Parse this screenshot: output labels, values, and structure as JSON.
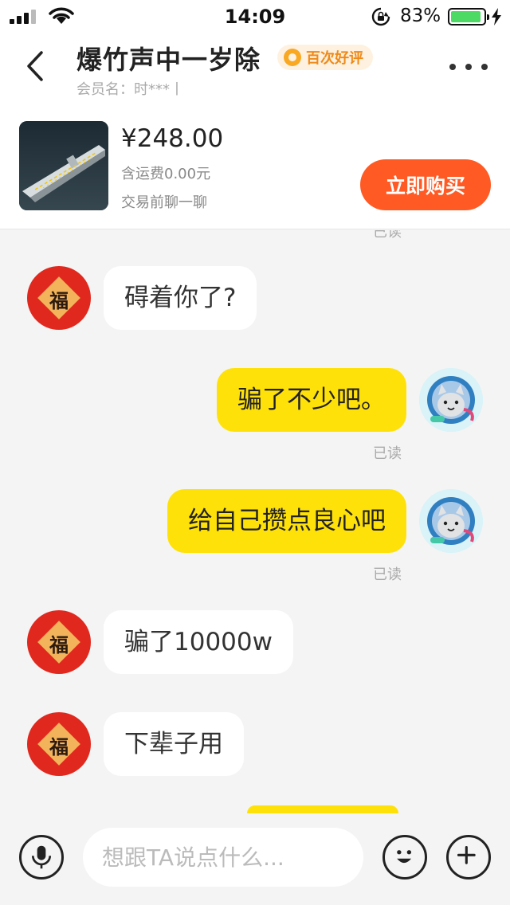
{
  "status_bar": {
    "time": "14:09",
    "battery_percent": "83%",
    "battery_level": 0.83,
    "icons": [
      "signal-icon",
      "wifi-icon",
      "rotation-lock-icon",
      "battery-icon",
      "charging-icon"
    ]
  },
  "header": {
    "title": "爆竹声中一岁除",
    "badge": "百次好评",
    "member_label": "会员名：时***丨",
    "icons": [
      "back-icon",
      "more-icon"
    ]
  },
  "product": {
    "price": "¥248.00",
    "shipping": "含运费0.00元",
    "chat_hint": "交易前聊一聊",
    "buy_label": "立即购买",
    "image": "aircraft-carrier-model"
  },
  "chat": {
    "messages": [
      {
        "from": "them",
        "text": "碍着你了?"
      },
      {
        "from": "me",
        "text": "骗了不少吧。",
        "status": "已读"
      },
      {
        "from": "me",
        "text": "给自己攒点良心吧",
        "status": "已读"
      },
      {
        "from": "them",
        "text": "骗了10000w"
      },
      {
        "from": "them",
        "text": "下辈子用"
      }
    ],
    "partial_read_status": "已读",
    "avatar_char": "福"
  },
  "input_bar": {
    "placeholder": "想跟TA说点什么...",
    "icons": [
      "microphone-icon",
      "emoji-icon",
      "plus-icon"
    ]
  },
  "colors": {
    "outgoing_bubble": "#ffe10a",
    "incoming_bubble": "#ffffff",
    "buy_button": "#ff5a24",
    "background": "#f4f4f4",
    "badge_text": "#ee8a1a"
  }
}
